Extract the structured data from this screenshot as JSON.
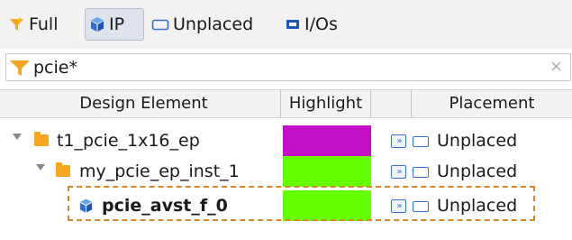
{
  "toolbar": {
    "full_label": "Full",
    "ip_label": "IP",
    "unplaced_label": "Unplaced",
    "ios_label": "I/Os"
  },
  "search": {
    "value": "pcie*",
    "clear_glyph": "×"
  },
  "table": {
    "columns": [
      "Design Element",
      "Highlight",
      "",
      "Placement"
    ],
    "rows": [
      {
        "name": "t1_pcie_1x16_ep",
        "icon": "folder-icon",
        "highlight_color": "#c30fc3",
        "placement": "Unplaced"
      },
      {
        "name": "my_pcie_ep_inst_1",
        "icon": "folder-icon",
        "highlight_color": "#66ff00",
        "placement": "Unplaced"
      },
      {
        "name": "pcie_avst_f_0",
        "icon": "ip-cube-icon",
        "highlight_color": "#66ff00",
        "placement": "Unplaced"
      }
    ]
  },
  "colors": {
    "accent_blue": "#3b6fd8",
    "filter_orange": "#f5a623",
    "selection_outline": "#d4872b"
  }
}
